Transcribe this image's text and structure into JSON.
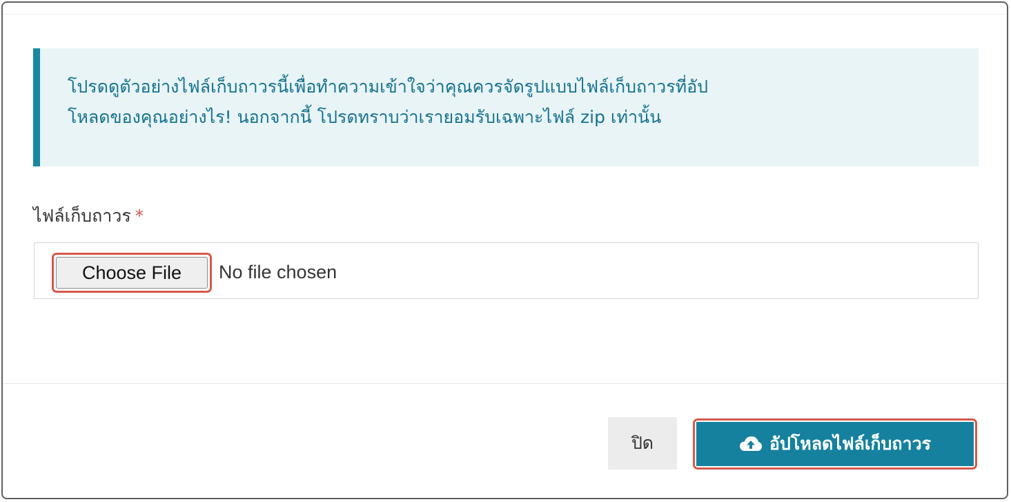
{
  "info": {
    "line1": "โปรดดูตัวอย่างไฟล์เก็บถาวรนี้เพื่อทำความเข้าใจว่าคุณควรจัดรูปแบบไฟล์เก็บถาวรที่อัป",
    "line2": "โหลดของคุณอย่างไร! นอกจากนี้ โปรดทราบว่าเรายอมรับเฉพาะไฟล์ zip เท่านั้น"
  },
  "form": {
    "archive_label": "ไฟล์เก็บถาวร",
    "required_marker": "*",
    "choose_file_label": "Choose File",
    "no_file_text": "No file chosen"
  },
  "footer": {
    "close_label": "ปิด",
    "upload_label": "อัปโหลดไฟล์เก็บถาวร",
    "upload_icon": "cloud-upload-icon"
  },
  "colors": {
    "accent": "#1787a3",
    "info_bg": "#e8f4f6",
    "info_text": "#16718e",
    "primary_button": "#16819e",
    "required": "#d9534f",
    "highlight": "#d7584b"
  }
}
